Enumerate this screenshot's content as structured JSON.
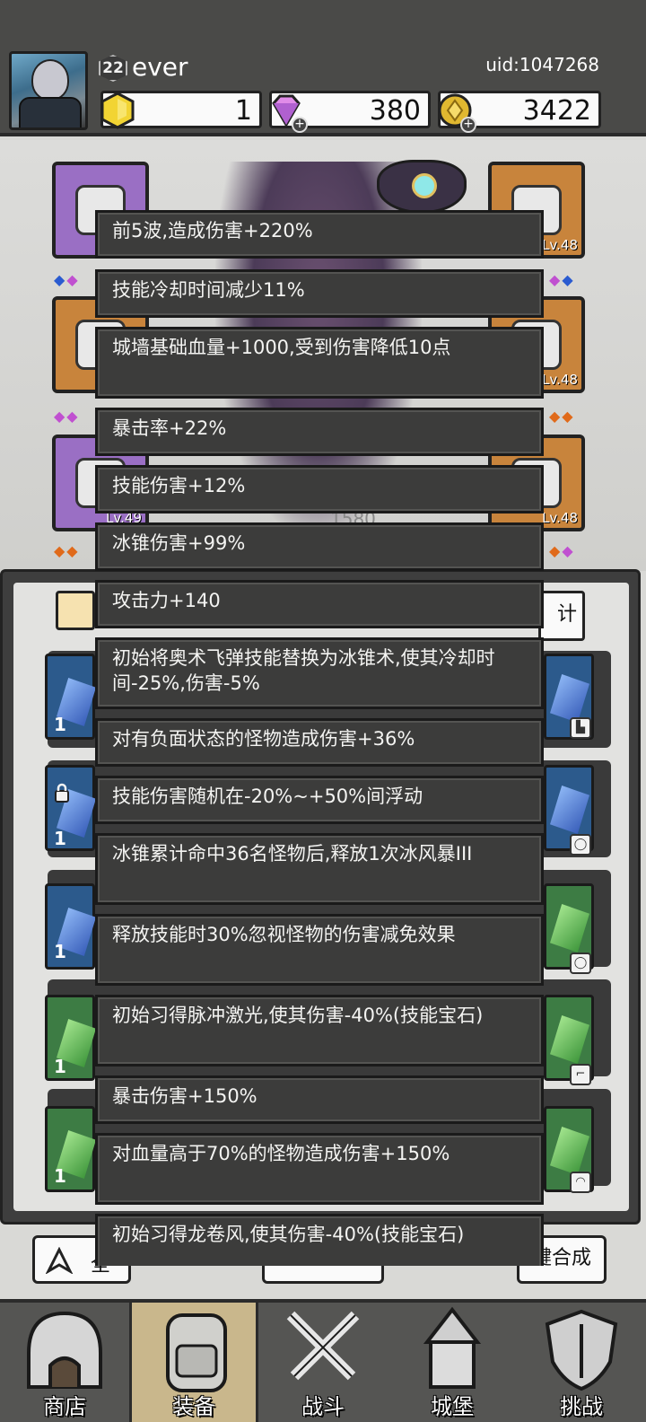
{
  "player": {
    "level": "22",
    "name": "ever",
    "uid": "uid:1047268"
  },
  "resources": {
    "gold_hex": "1",
    "diamond": "380",
    "coin": "3422"
  },
  "equipment": {
    "levels": [
      "Lv.48",
      "Lv.48",
      "Lv.48",
      "Lv.49"
    ],
    "power": "1580"
  },
  "tabs": {
    "right_partial": "计"
  },
  "inventory": {
    "counts": [
      "1",
      "1",
      "1",
      "1",
      "1"
    ]
  },
  "actions": {
    "left_partial": "全",
    "right_partial": "键合成"
  },
  "tooltip_items": [
    "前5波,造成伤害+220%",
    "技能冷却时间减少11%",
    "城墙基础血量+1000,受到伤害降低10点",
    "暴击率+22%",
    "技能伤害+12%",
    "冰锥伤害+99%",
    "攻击力+140",
    "初始将奥术飞弹技能替换为冰锥术,使其冷却时间-25%,伤害-5%",
    "对有负面状态的怪物造成伤害+36%",
    "技能伤害随机在-20%~+50%间浮动",
    "冰锥累计命中36名怪物后,释放1次冰风暴III",
    "释放技能时30%忽视怪物的伤害减免效果",
    "初始习得脉冲激光,使其伤害-40%(技能宝石)",
    "暴击伤害+150%",
    "对血量高于70%的怪物造成伤害+150%",
    "初始习得龙卷风,使其伤害-40%(技能宝石)"
  ],
  "nav": [
    {
      "label": "商店"
    },
    {
      "label": "装备"
    },
    {
      "label": "战斗"
    },
    {
      "label": "城堡"
    },
    {
      "label": "挑战"
    }
  ],
  "colors": {
    "header_bg": "#4a4a48",
    "tooltip_bg": "#3c3c3b",
    "slot_purple": "#9a6fc4",
    "slot_orange": "#c8843c",
    "nav_active": "#c9b78c"
  }
}
